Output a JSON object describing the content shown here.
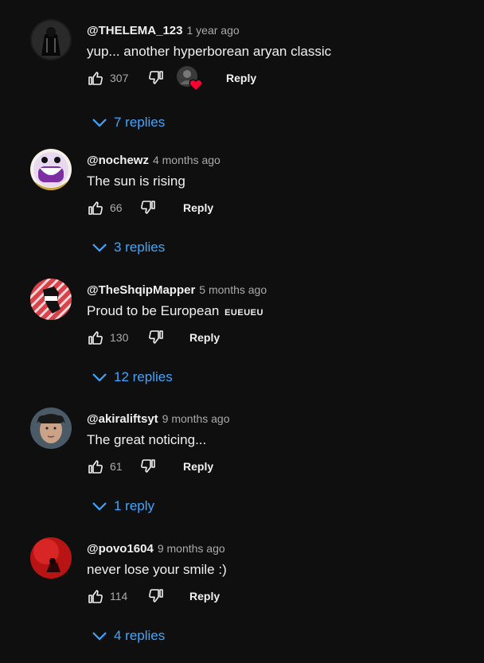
{
  "comments": [
    {
      "author": "@THELEMA_123",
      "time": "1 year ago",
      "text": "yup... another hyperborean aryan classic",
      "text_suffix": "",
      "likes": "307",
      "reply_label": "Reply",
      "replies_label": "7 replies",
      "creator_heart": true,
      "avatar_icon": "dark-figure-avatar"
    },
    {
      "author": "@nochewz",
      "time": "4 months ago",
      "text": "The sun is rising",
      "text_suffix": "",
      "likes": "66",
      "reply_label": "Reply",
      "replies_label": "3 replies",
      "creator_heart": false,
      "avatar_icon": "grinning-face-avatar"
    },
    {
      "author": "@TheShqipMapper",
      "time": "5 months ago",
      "text": "Proud to be European",
      "text_suffix": "EUEUEU",
      "likes": "130",
      "reply_label": "Reply",
      "replies_label": "12 replies",
      "creator_heart": false,
      "avatar_icon": "striped-map-avatar"
    },
    {
      "author": "@akiraliftsyt",
      "time": "9 months ago",
      "text": "The great noticing...",
      "text_suffix": "",
      "likes": "61",
      "reply_label": "Reply",
      "replies_label": "1 reply",
      "creator_heart": false,
      "avatar_icon": "person-photo-avatar"
    },
    {
      "author": "@povo1604",
      "time": "9 months ago",
      "text": "never lose your smile :)",
      "text_suffix": "",
      "likes": "114",
      "reply_label": "Reply",
      "replies_label": "4 replies",
      "creator_heart": false,
      "avatar_icon": "red-scene-avatar"
    }
  ],
  "colors": {
    "background": "#0f0f0f",
    "text": "#f1f1f1",
    "secondary": "#aaaaaa",
    "link": "#3ea6ff",
    "heart": "#ff0033"
  }
}
